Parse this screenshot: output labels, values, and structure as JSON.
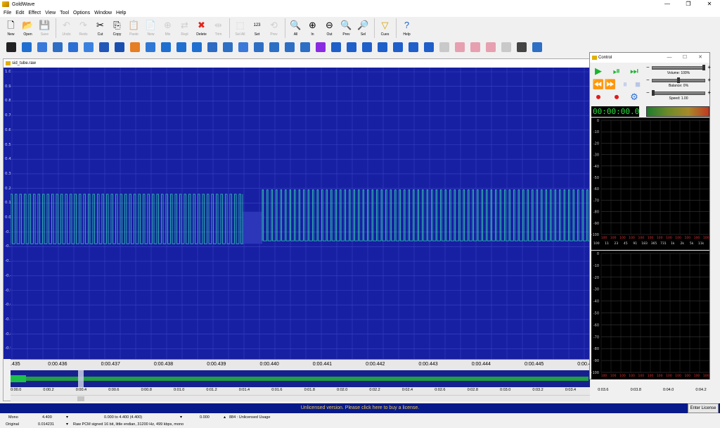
{
  "app": {
    "title": "GoldWave",
    "window_controls": [
      "—",
      "❐",
      "✕"
    ]
  },
  "menu": [
    "File",
    "Edit",
    "Effect",
    "View",
    "Tool",
    "Options",
    "Window",
    "Help"
  ],
  "toolbar": [
    {
      "label": "New",
      "icon": "new-icon",
      "glyph": "🗋",
      "enabled": true
    },
    {
      "label": "Open",
      "icon": "open-icon",
      "glyph": "📂",
      "enabled": true
    },
    {
      "label": "Save",
      "icon": "save-icon",
      "glyph": "💾",
      "enabled": false
    },
    {
      "sep": true
    },
    {
      "label": "Undo",
      "icon": "undo-icon",
      "glyph": "↶",
      "enabled": false
    },
    {
      "label": "Redo",
      "icon": "redo-icon",
      "glyph": "↷",
      "enabled": false
    },
    {
      "label": "Cut",
      "icon": "cut-icon",
      "glyph": "✂",
      "enabled": true
    },
    {
      "label": "Copy",
      "icon": "copy-icon",
      "glyph": "⎘",
      "enabled": true
    },
    {
      "label": "Paste",
      "icon": "paste-icon",
      "glyph": "📋",
      "enabled": false
    },
    {
      "label": "New",
      "icon": "paste-new-icon",
      "glyph": "📄",
      "enabled": false
    },
    {
      "label": "Mix",
      "icon": "mix-icon",
      "glyph": "⊕",
      "enabled": false
    },
    {
      "label": "Repl",
      "icon": "replace-icon",
      "glyph": "⇄",
      "enabled": false
    },
    {
      "label": "Delete",
      "icon": "delete-icon",
      "glyph": "✖",
      "enabled": true,
      "color": "#e0241b"
    },
    {
      "label": "Trim",
      "icon": "trim-icon",
      "glyph": "⇹",
      "enabled": false
    },
    {
      "sep": true
    },
    {
      "label": "Sel All",
      "icon": "select-all-icon",
      "glyph": "⬚",
      "enabled": false
    },
    {
      "label": "Set",
      "icon": "set-icon",
      "glyph": "123",
      "enabled": true,
      "small": true
    },
    {
      "label": "Prev",
      "icon": "prev-selection-icon",
      "glyph": "⟲",
      "enabled": false
    },
    {
      "sep": true
    },
    {
      "label": "All",
      "icon": "zoom-all-icon",
      "glyph": "🔍",
      "enabled": true
    },
    {
      "label": "In",
      "icon": "zoom-in-icon",
      "glyph": "⊕",
      "enabled": true
    },
    {
      "label": "Out",
      "icon": "zoom-out-icon",
      "glyph": "⊖",
      "enabled": true
    },
    {
      "label": "Prev",
      "icon": "zoom-prev-icon",
      "glyph": "🔍",
      "enabled": true
    },
    {
      "label": "Sel",
      "icon": "zoom-selection-icon",
      "glyph": "🔎",
      "enabled": true
    },
    {
      "sep": true
    },
    {
      "label": "Cues",
      "icon": "cues-icon",
      "glyph": "▽",
      "enabled": true,
      "color": "#d4a200"
    },
    {
      "sep": true
    },
    {
      "label": "Help",
      "icon": "help-icon",
      "glyph": "?",
      "enabled": true,
      "color": "#1f5fc9"
    }
  ],
  "effects_toolbar": [
    {
      "icon": "doppler-icon",
      "color": "#222222"
    },
    {
      "icon": "dynamics-icon",
      "color": "#1f6fd0"
    },
    {
      "icon": "echo-icon",
      "color": "#3a79d9"
    },
    {
      "icon": "filter-icon",
      "color": "#2d6fc4"
    },
    {
      "icon": "flanger-icon",
      "color": "#2c6fd4"
    },
    {
      "icon": "invert-icon",
      "color": "#3b82e0"
    },
    {
      "icon": "mechanize-icon",
      "color": "#2356b8"
    },
    {
      "icon": "offset-icon",
      "color": "#1a4fb0"
    },
    {
      "icon": "pitch-icon",
      "color": "#e67e22"
    },
    {
      "icon": "eq-icon",
      "color": "#2f78d6"
    },
    {
      "icon": "reverse-icon",
      "color": "#1f6fd0"
    },
    {
      "icon": "reverse-left-icon",
      "color": "#1f6fd0"
    },
    {
      "icon": "pan-icon",
      "color": "#1f6fd0"
    },
    {
      "icon": "resample-icon",
      "color": "#2e6bc2"
    },
    {
      "icon": "equalizer-icon",
      "color": "#2d6fc4"
    },
    {
      "icon": "noise-reduction-icon",
      "color": "#3a79d9"
    },
    {
      "icon": "interpolate-icon",
      "color": "#2d6fc4"
    },
    {
      "icon": "channel-mixer-icon",
      "color": "#2d6fc4"
    },
    {
      "icon": "pop-click-icon",
      "color": "#2d6fc4"
    },
    {
      "icon": "stereo-icon",
      "color": "#2d6fc4"
    },
    {
      "icon": "matrix-icon",
      "color": "#8a2be2"
    },
    {
      "icon": "fade-in-icon",
      "color": "#1f5fc9"
    },
    {
      "icon": "fade-out-icon",
      "color": "#1f5fc9"
    },
    {
      "icon": "shape-volume-icon",
      "color": "#1f5fc9"
    },
    {
      "icon": "maximize-icon",
      "color": "#1f5fc9"
    },
    {
      "icon": "volume-down-icon",
      "color": "#1f5fc9"
    },
    {
      "icon": "volume-up-icon",
      "color": "#1f5fc9"
    },
    {
      "icon": "speaker-icon",
      "color": "#1f5fc9"
    },
    {
      "icon": "silence-icon",
      "color": "#c9c9c9"
    },
    {
      "icon": "cue-icon",
      "color": "#e6a0b0"
    },
    {
      "icon": "marker-icon",
      "color": "#e6a0b0"
    },
    {
      "icon": "link-icon",
      "color": "#e6a0b0"
    },
    {
      "icon": "presets-icon",
      "color": "#c9c9c9"
    },
    {
      "icon": "timer-icon",
      "color": "#444444"
    },
    {
      "icon": "batch-icon",
      "color": "#2d6fc4"
    }
  ],
  "document": {
    "filename": "sid_tube.raw",
    "y_labels": [
      "1.0",
      "0.9",
      "0.8",
      "0.7",
      "0.6",
      "0.5",
      "0.4",
      "0.3",
      "0.2",
      "0.1",
      "0.0",
      "-0.1",
      "-0.2",
      "-0.3",
      "-0.4",
      "-0.5",
      "-0.6",
      "-0.7",
      "-0.8",
      "-0.9"
    ],
    "time_labels": [
      ".435",
      "0:00.436",
      "0:00.437",
      "0:00.438",
      "0:00.439",
      "0:00.440",
      "0:00.441",
      "0:00.442",
      "0:00.443",
      "0:00.444",
      "0:00.445",
      "0:00.446"
    ],
    "overview_labels": [
      "0:00.0",
      "0:00.2",
      "0:00.4",
      "0:00.6",
      "0:00.8",
      "0:01.0",
      "0:01.2",
      "0:01.4",
      "0:01.6",
      "0:01.8",
      "0:02.0",
      "0:02.2",
      "0:02.4",
      "0:02.6",
      "0:02.8",
      "0:03.0",
      "0:03.2",
      "0:03.4",
      "0:03.6",
      "0:03.8",
      "0:04.0",
      "0:04.2"
    ],
    "wave_color": "#2fd1a8",
    "bg_color": "#171fa3"
  },
  "control": {
    "title": "Control",
    "volume_label": "Volume: 100%",
    "balance_label": "Balance: 0%",
    "speed_label": "Speed: 1.00",
    "volume_level": 1.0,
    "balance_level": 0.5,
    "speed_level": 0.0,
    "counter": "00:00:00.0",
    "spectrum_ylabels": [
      "0",
      "-10",
      "-20",
      "-30",
      "-40",
      "-50",
      "-60",
      "-70",
      "-80",
      "-90",
      "-100"
    ],
    "spectrum_values": [
      "100",
      "100",
      "100",
      "100",
      "100",
      "100",
      "100",
      "100",
      "100",
      "100",
      "100",
      "100"
    ],
    "spectrum_freqs": [
      "11",
      "23",
      "45",
      "91",
      "183",
      "365",
      "731",
      "1k",
      "2k",
      "5k",
      "11k"
    ]
  },
  "status": {
    "license_message": "Unlicensed version. Please click here to buy a license.",
    "enter_license": "Enter License",
    "channel": "Mono",
    "length": "4.400",
    "selection": "0.000 to 4.400 (4.400)",
    "position": "0.000",
    "usage": "884 : Unlicensed Usage",
    "original": "Original",
    "value": "0.014231",
    "format": "Raw PCM signed 16 bit, little endian, 31200 Hz, 499 kbps, mono"
  }
}
